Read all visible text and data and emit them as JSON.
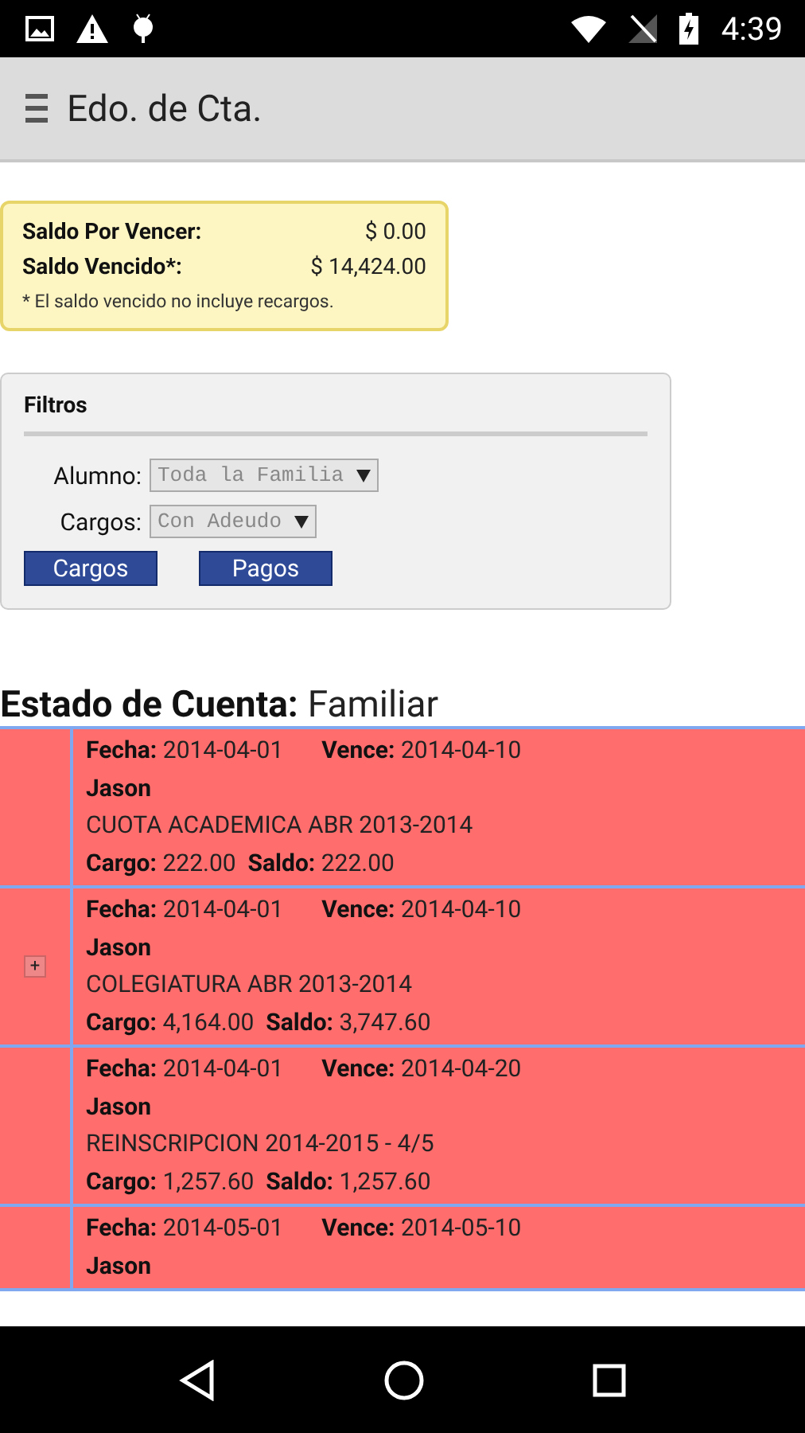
{
  "status_bar": {
    "time": "4:39"
  },
  "app_bar": {
    "title": "Edo. de Cta."
  },
  "balance": {
    "rows": [
      {
        "label": "Saldo Por Vencer:",
        "value": "$ 0.00"
      },
      {
        "label": "Saldo Vencido*:",
        "value": "$ 14,424.00"
      }
    ],
    "note": "* El saldo vencido no incluye recargos."
  },
  "filters": {
    "title": "Filtros",
    "fields": [
      {
        "label": "Alumno:",
        "value": "Toda la Familia"
      },
      {
        "label": "Cargos:",
        "value": "Con Adeudo"
      }
    ],
    "buttons": [
      "Cargos",
      "Pagos"
    ]
  },
  "statement": {
    "label": "Estado de Cuenta:",
    "value": "Familiar",
    "rows": [
      {
        "expandable": false,
        "fecha_label": "Fecha:",
        "fecha": "2014-04-01",
        "vence_label": "Vence:",
        "vence": "2014-04-10",
        "student": "Jason",
        "description": "CUOTA ACADEMICA ABR 2013-2014",
        "cargo_label": "Cargo:",
        "cargo": "222.00",
        "saldo_label": "Saldo:",
        "saldo": "222.00"
      },
      {
        "expandable": true,
        "expand_symbol": "+",
        "fecha_label": "Fecha:",
        "fecha": "2014-04-01",
        "vence_label": "Vence:",
        "vence": "2014-04-10",
        "student": "Jason",
        "description": "COLEGIATURA ABR 2013-2014",
        "cargo_label": "Cargo:",
        "cargo": "4,164.00",
        "saldo_label": "Saldo:",
        "saldo": "3,747.60"
      },
      {
        "expandable": false,
        "fecha_label": "Fecha:",
        "fecha": "2014-04-01",
        "vence_label": "Vence:",
        "vence": "2014-04-20",
        "student": "Jason",
        "description": "REINSCRIPCION 2014-2015 - 4/5",
        "cargo_label": "Cargo:",
        "cargo": "1,257.60",
        "saldo_label": "Saldo:",
        "saldo": "1,257.60"
      },
      {
        "expandable": false,
        "fecha_label": "Fecha:",
        "fecha": "2014-05-01",
        "vence_label": "Vence:",
        "vence": "2014-05-10",
        "student": "Jason"
      }
    ]
  }
}
